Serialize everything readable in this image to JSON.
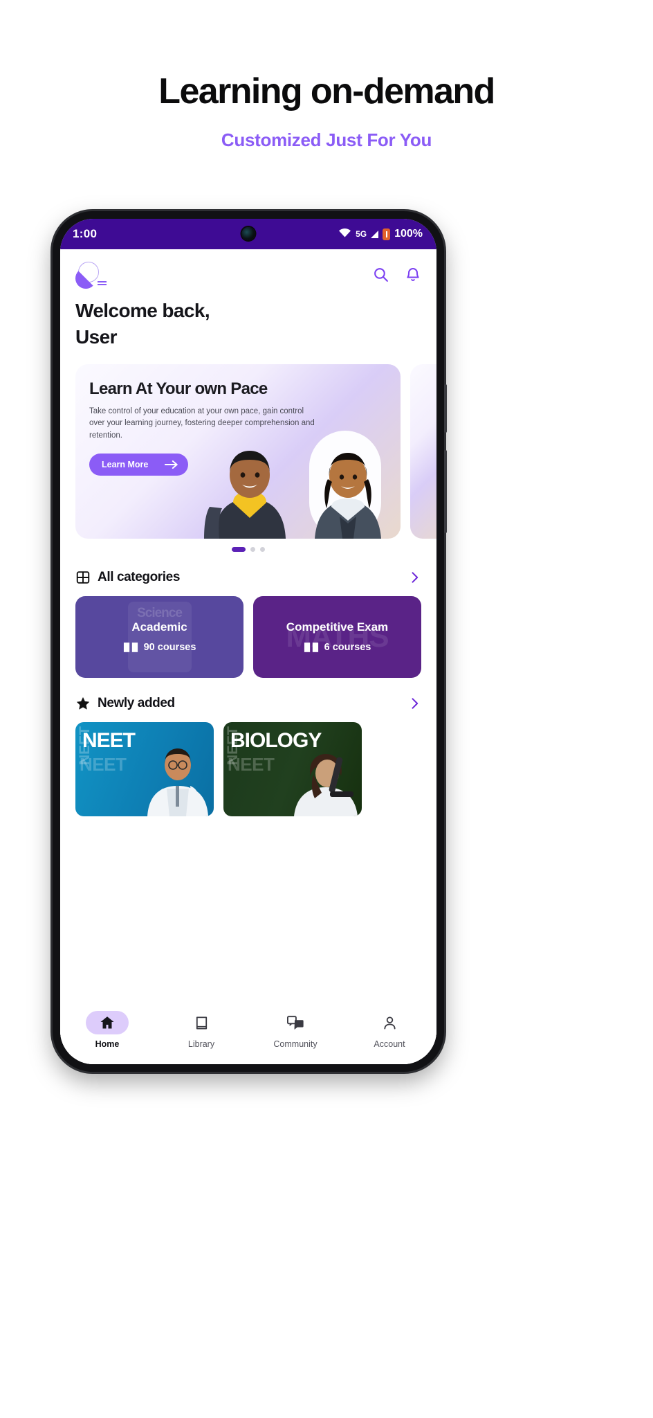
{
  "promo": {
    "title": "Learning on-demand",
    "subtitle": "Customized Just For You",
    "accent_color": "#8b5cf6"
  },
  "status_bar": {
    "time": "1:00",
    "network_type": "5G",
    "battery_percent": "100%",
    "icons": [
      "wifi-icon",
      "signal-icon",
      "battery-icon"
    ],
    "background_color": "#3e0b94"
  },
  "app_header": {
    "logo_name": "app-logo",
    "search_label": "search-icon",
    "notifications_label": "bell-icon"
  },
  "welcome": {
    "line1": "Welcome back,",
    "line2": "User"
  },
  "banner": {
    "title": "Learn At Your own Pace",
    "description": "Take control of your education at your own pace, gain control over your learning journey, fostering deeper comprehension and retention.",
    "cta_label": "Learn More",
    "cta_color": "#8b5cf6",
    "dots": 3,
    "active_dot": 0
  },
  "categories_section": {
    "title": "All categories",
    "icon": "grid-icon",
    "chevron": "chevron-right-icon",
    "cards": [
      {
        "name": "Academic",
        "courses": "90 courses",
        "ghost": "Science",
        "color": "#57489e"
      },
      {
        "name": "Competitive Exam",
        "courses": "6 courses",
        "ghost": "MATHS",
        "color": "#5a2387"
      }
    ]
  },
  "newly_added_section": {
    "title": "Newly added",
    "icon": "star-icon",
    "chevron": "chevron-right-icon",
    "cards": [
      {
        "title": "NEET",
        "ghost": "NEET",
        "ghost_v": "NEET"
      },
      {
        "title": "BIOLOGY",
        "ghost": "NEET",
        "ghost_v": "NEET"
      }
    ]
  },
  "bottom_nav": {
    "items": [
      {
        "label": "Home",
        "icon": "home-icon",
        "active": true
      },
      {
        "label": "Library",
        "icon": "book-icon",
        "active": false
      },
      {
        "label": "Community",
        "icon": "chat-icon",
        "active": false
      },
      {
        "label": "Account",
        "icon": "person-icon",
        "active": false
      }
    ]
  }
}
